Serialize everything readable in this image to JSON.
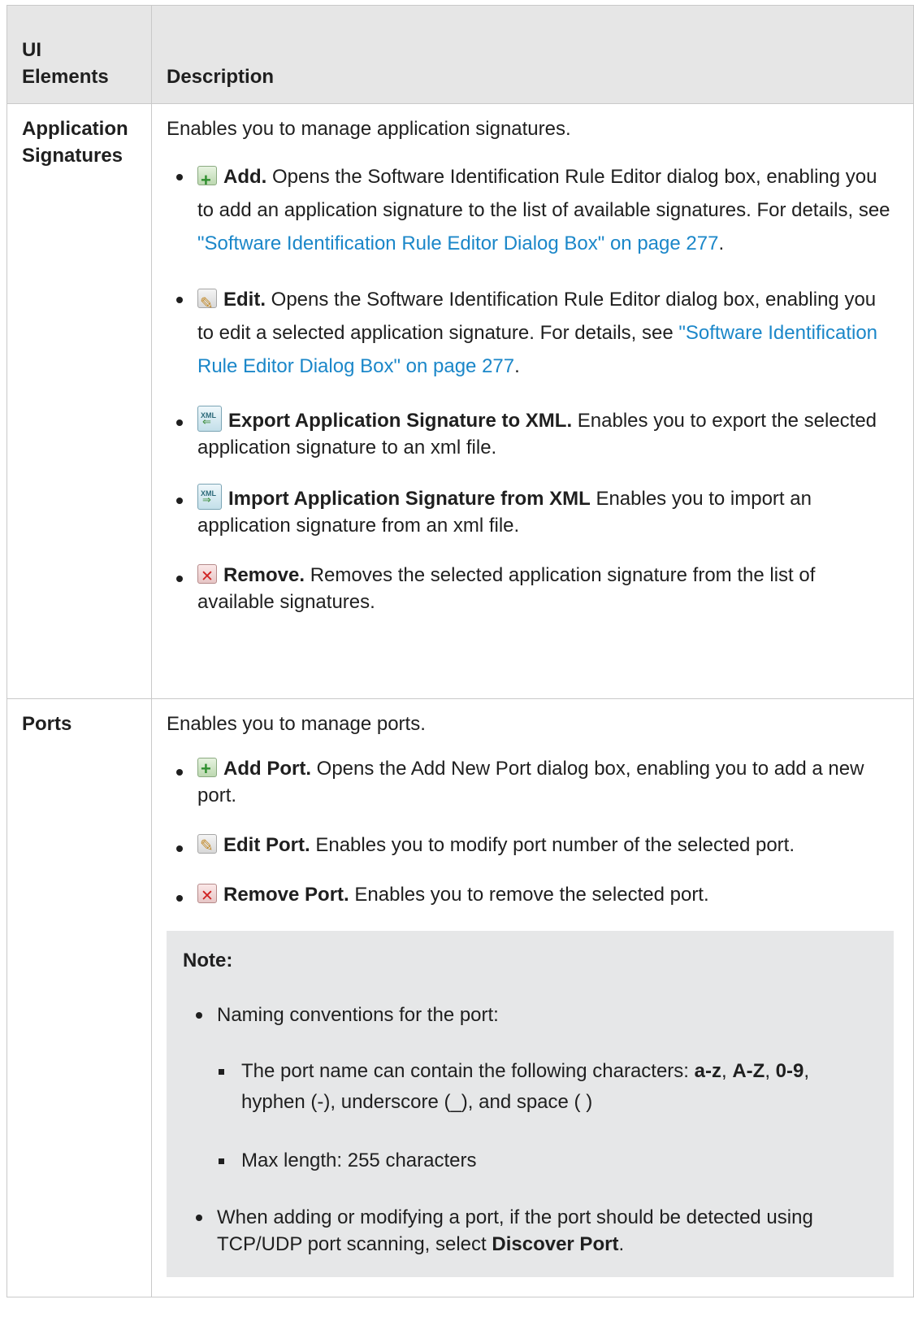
{
  "header": {
    "col1_line1": "UI",
    "col1_line2": "Elements",
    "col2": "Description"
  },
  "rows": [
    {
      "name_line1": "Application",
      "name_line2": "Signatures",
      "intro": "Enables you to manage application signatures.",
      "items": [
        {
          "icon": "add-icon",
          "label": "Add.",
          "text": " Opens the Software Identification Rule Editor dialog box, enabling you to add an application signature to the list of available signatures. For details, see ",
          "link": "\"Software Identification Rule Editor Dialog Box\" on page 277",
          "after": "."
        },
        {
          "icon": "edit-icon",
          "label": "Edit.",
          "text": " Opens the Software Identification Rule Editor dialog box, enabling you to edit a selected application signature. For details, see ",
          "link": "\"Software Identification Rule Editor Dialog Box\" on page 277",
          "after": "."
        },
        {
          "icon": "export-xml-icon",
          "label": "Export Application Signature to XML.",
          "text": " Enables you to export the selected application signature to an xml file."
        },
        {
          "icon": "import-xml-icon",
          "label": "Import Application Signature from XML",
          "text": " Enables you to import an application signature from an xml file."
        },
        {
          "icon": "remove-icon",
          "label": "Remove.",
          "text": " Removes the selected application signature from the list of available signatures."
        }
      ]
    },
    {
      "name": "Ports",
      "intro": "Enables you to manage ports.",
      "items": [
        {
          "icon": "add-icon",
          "label": "Add Port.",
          "text": " Opens the Add New Port dialog box, enabling you to add a new port."
        },
        {
          "icon": "edit-icon",
          "label": "Edit Port.",
          "text": " Enables you to modify port number of the selected port."
        },
        {
          "icon": "remove-icon",
          "label": "Remove Port.",
          "text": " Enables you to remove the selected port."
        }
      ],
      "note": {
        "title": "Note:",
        "bullet1": "Naming conventions for the port:",
        "sub1_text": "The port name can contain the following characters: ",
        "sub1_b1": "a-z",
        "sub1_sep1": ", ",
        "sub1_b2": "A-Z",
        "sub1_sep2": ", ",
        "sub1_b3": "0-9",
        "sub1_tail": ", hyphen (-), underscore (_), and space ( )",
        "sub2": "Max length: 255 characters",
        "bullet2_text": "When adding or modifying a port, if the port should be detected using TCP/UDP port scanning, select ",
        "bullet2_bold": "Discover Port",
        "bullet2_after": "."
      }
    }
  ]
}
